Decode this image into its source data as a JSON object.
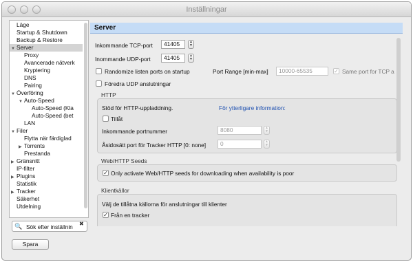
{
  "window": {
    "title": "Inställningar"
  },
  "sidebar": {
    "items": [
      {
        "label": "Läge",
        "indent": 0,
        "arrow": ""
      },
      {
        "label": "Startup & Shutdown",
        "indent": 0,
        "arrow": ""
      },
      {
        "label": "Backup & Restore",
        "indent": 0,
        "arrow": ""
      },
      {
        "label": "Server",
        "indent": 0,
        "arrow": "▼",
        "selected": true
      },
      {
        "label": "Proxy",
        "indent": 1,
        "arrow": ""
      },
      {
        "label": "Avancerade nätverk",
        "indent": 1,
        "arrow": ""
      },
      {
        "label": "Kryptering",
        "indent": 1,
        "arrow": ""
      },
      {
        "label": "DNS",
        "indent": 1,
        "arrow": ""
      },
      {
        "label": "Pairing",
        "indent": 1,
        "arrow": ""
      },
      {
        "label": "Överföring",
        "indent": 0,
        "arrow": "▼"
      },
      {
        "label": "Auto-Speed",
        "indent": 1,
        "arrow": "▼"
      },
      {
        "label": "Auto-Speed (Kla",
        "indent": 2,
        "arrow": ""
      },
      {
        "label": "Auto-Speed (bet",
        "indent": 2,
        "arrow": ""
      },
      {
        "label": "LAN",
        "indent": 1,
        "arrow": ""
      },
      {
        "label": "Filer",
        "indent": 0,
        "arrow": "▼"
      },
      {
        "label": "Flytta när färdiglad",
        "indent": 1,
        "arrow": ""
      },
      {
        "label": "Torrents",
        "indent": 1,
        "arrow": "▶"
      },
      {
        "label": "Prestanda",
        "indent": 1,
        "arrow": ""
      },
      {
        "label": "Gränsnitt",
        "indent": 0,
        "arrow": "▶"
      },
      {
        "label": "IP-filter",
        "indent": 0,
        "arrow": ""
      },
      {
        "label": "Plugins",
        "indent": 0,
        "arrow": "▶"
      },
      {
        "label": "Statistik",
        "indent": 0,
        "arrow": ""
      },
      {
        "label": "Tracker",
        "indent": 0,
        "arrow": "▶"
      },
      {
        "label": "Säkerhet",
        "indent": 0,
        "arrow": ""
      },
      {
        "label": "Utdelning",
        "indent": 0,
        "arrow": ""
      }
    ]
  },
  "search": {
    "value": "Sök efter inställnin",
    "icon": "magnifier-icon",
    "clear": "✖"
  },
  "save_label": "Spara",
  "panel": {
    "title": "Server",
    "tcp_label": "Inkommande TCP-port",
    "tcp_value": "41405",
    "udp_label": "Inommande UDP-port",
    "udp_value": "41405",
    "randomize_label": "Randomize listen ports on startup",
    "port_range_label": "Port Range [min-max]",
    "port_range_value": "10000-65535",
    "same_port_label": "Same port for TCP a",
    "prefer_udp_label": "Föredra UDP anslutningar",
    "http": {
      "title": "HTTP",
      "support_label": "Stöd för HTTP-uppladdning.",
      "info_link": "För ytterligare information:",
      "allow_label": "Tillåt",
      "incoming_label": "Inkommande portnummer",
      "incoming_value": "8080",
      "override_label": "Åsidosätt port för Tracker HTTP [0: none]",
      "override_value": "0"
    },
    "webseeds": {
      "title": "Web/HTTP Seeds",
      "only_label": "Only activate Web/HTTP seeds for downloading when availability is poor"
    },
    "sources": {
      "title": "Klientkällor",
      "desc": "Välj de tillåtna källorna för anslutningar till klienter",
      "tracker_label": "Från en tracker"
    }
  }
}
